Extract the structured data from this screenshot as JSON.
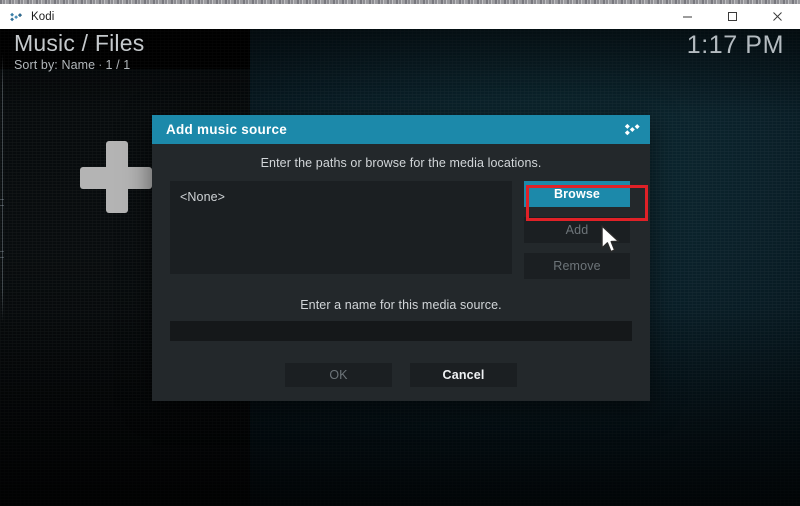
{
  "window": {
    "app_title": "Kodi",
    "app_icon": "kodi-logo-icon",
    "minimize_label": "—",
    "maximize_label": "□",
    "close_label": "✕"
  },
  "kodi": {
    "breadcrumb": "Music / Files",
    "sort_info": "Sort by: Name",
    "separator": "·",
    "page_info": "1 / 1",
    "clock": "1:17 PM",
    "placeholder_icon": "plus-icon"
  },
  "dialog": {
    "title": "Add music source",
    "logo_icon": "kodi-logo-icon",
    "hint_paths": "Enter the paths or browse for the media locations.",
    "path_list": [
      "<None>"
    ],
    "side_buttons": [
      {
        "label": "Browse",
        "state": "focused"
      },
      {
        "label": "Add",
        "state": "disabled"
      },
      {
        "label": "Remove",
        "state": "disabled"
      }
    ],
    "hint_name": "Enter a name for this media source.",
    "name_value": "",
    "name_placeholder": "",
    "actions": [
      {
        "label": "OK",
        "state": "disabled"
      },
      {
        "label": "Cancel",
        "state": "enabled"
      }
    ]
  },
  "annotation": {
    "highlight_color": "#e02127",
    "highlight_target": "Browse"
  },
  "colors": {
    "accent": "#1c89aa",
    "dialog_body": "#23282b",
    "control_bg": "#1b1f22",
    "text_primary": "#d2d6d9",
    "text_dim": "#6d7479"
  }
}
